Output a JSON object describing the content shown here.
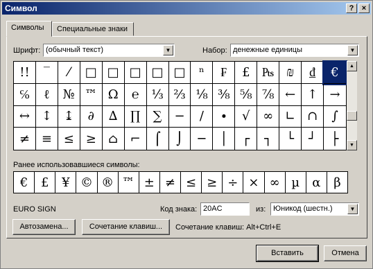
{
  "window": {
    "title": "Символ"
  },
  "title_buttons": {
    "help": "?",
    "close": "×"
  },
  "tabs": [
    {
      "label": "Символы"
    },
    {
      "label": "Специальные знаки"
    }
  ],
  "font": {
    "label": "Шрифт:",
    "value": "(обычный текст)"
  },
  "subset": {
    "label": "Набор:",
    "value": "денежные единицы"
  },
  "symbol_grid": [
    [
      "!!",
      "‾",
      "⁄",
      "□",
      "□",
      "□",
      "□",
      "□",
      "ⁿ",
      "₣",
      "£",
      "₧",
      "₪",
      "₫",
      "€"
    ],
    [
      "℅",
      "ℓ",
      "№",
      "™",
      "Ω",
      "℮",
      "⅓",
      "⅔",
      "⅛",
      "⅜",
      "⅝",
      "⅞",
      "←",
      "↑",
      "→",
      "↓"
    ],
    [
      "↔",
      "↕",
      "↨",
      "∂",
      "∆",
      "∏",
      "∑",
      "−",
      "∕",
      "∙",
      "√",
      "∞",
      "∟",
      "∩",
      "∫",
      "≈"
    ],
    [
      "≠",
      "≡",
      "≤",
      "≥",
      "⌂",
      "⌐",
      "⌠",
      "⌡",
      "─",
      "│",
      "┌",
      "┐",
      "└",
      "┘",
      "├",
      "┤"
    ]
  ],
  "selected_symbol": "€",
  "recent": {
    "label": "Ранее использовавшиеся символы:",
    "symbols": [
      "€",
      "£",
      "¥",
      "©",
      "®",
      "™",
      "±",
      "≠",
      "≤",
      "≥",
      "÷",
      "×",
      "∞",
      "µ",
      "α",
      "β"
    ]
  },
  "char_name": "EURO SIGN",
  "char_code": {
    "label": "Код знака:",
    "value": "20AC"
  },
  "from": {
    "label": "из:",
    "value": "Юникод (шестн.)"
  },
  "buttons": {
    "autocorrect": "Автозамена...",
    "shortcut": "Сочетание клавиш...",
    "insert": "Вставить",
    "cancel": "Отмена"
  },
  "shortcut_text": "Сочетание клавиш: Alt+Ctrl+E"
}
